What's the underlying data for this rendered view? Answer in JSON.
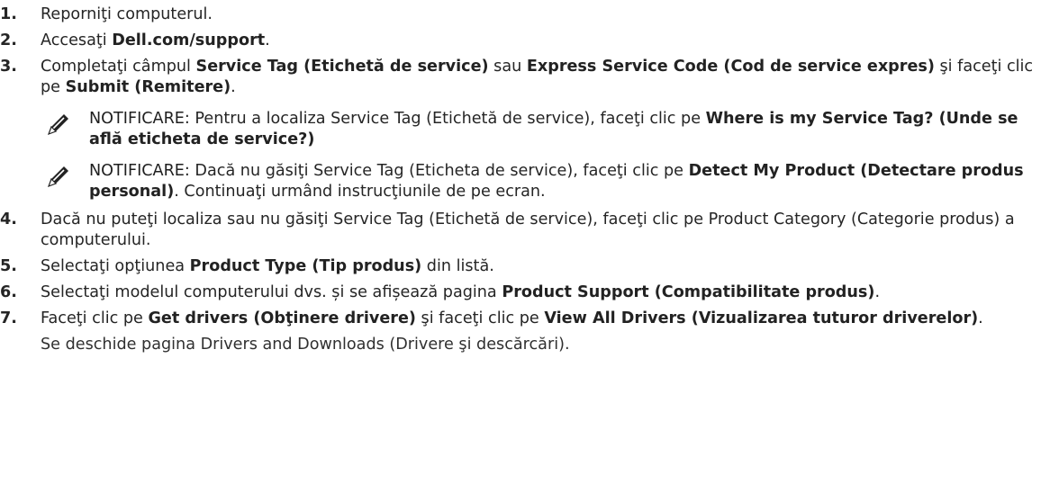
{
  "steps": [
    {
      "num": "1.",
      "parts": [
        {
          "t": "Reporniţi computerul.",
          "b": false
        }
      ]
    },
    {
      "num": "2.",
      "parts": [
        {
          "t": "Accesaţi ",
          "b": false
        },
        {
          "t": "Dell.com/support",
          "b": true
        },
        {
          "t": ".",
          "b": false
        }
      ]
    },
    {
      "num": "3.",
      "parts": [
        {
          "t": "Completaţi câmpul ",
          "b": false
        },
        {
          "t": "Service Tag (Etichetă de service)",
          "b": true
        },
        {
          "t": " sau ",
          "b": false
        },
        {
          "t": "Express Service Code (Cod de service expres)",
          "b": true
        },
        {
          "t": " şi faceţi clic pe ",
          "b": false
        },
        {
          "t": "Submit (Remitere)",
          "b": true
        },
        {
          "t": ".",
          "b": false
        }
      ]
    },
    {
      "num": "4.",
      "parts": [
        {
          "t": "Dacă nu puteţi localiza sau nu găsiţi Service Tag (Etichetă de service), faceţi clic pe Product Category (Categorie produs) a computerului.",
          "b": false
        }
      ]
    },
    {
      "num": "5.",
      "parts": [
        {
          "t": "Selectaţi opţiunea ",
          "b": false
        },
        {
          "t": "Product Type (Tip produs)",
          "b": true
        },
        {
          "t": " din listă.",
          "b": false
        }
      ]
    },
    {
      "num": "6.",
      "parts": [
        {
          "t": "Selectaţi modelul computerului dvs. și se afișează pagina ",
          "b": false
        },
        {
          "t": "Product Support (Compatibilitate produs)",
          "b": true
        },
        {
          "t": ".",
          "b": false
        }
      ]
    },
    {
      "num": "7.",
      "parts": [
        {
          "t": "Faceţi clic pe ",
          "b": false
        },
        {
          "t": "Get drivers (Obţinere drivere)",
          "b": true
        },
        {
          "t": " şi faceţi clic pe ",
          "b": false
        },
        {
          "t": "View All Drivers (Vizualizarea tuturor driverelor)",
          "b": true
        },
        {
          "t": ".",
          "b": false
        }
      ]
    }
  ],
  "notes": [
    {
      "label": "NOTIFICARE:",
      "parts": [
        {
          "t": " Pentru a localiza Service Tag (Etichetă de service), faceţi clic pe ",
          "b": false
        },
        {
          "t": "Where is my Service Tag? (Unde se află eticheta de service?)",
          "b": true
        }
      ]
    },
    {
      "label": "NOTIFICARE:",
      "parts": [
        {
          "t": " Dacă nu găsiţi Service Tag (Eticheta de service), faceţi clic pe ",
          "b": false
        },
        {
          "t": "Detect My Product (Detectare produs personal)",
          "b": true
        },
        {
          "t": ". Continuaţi urmând instrucţiunile de pe ecran.",
          "b": false
        }
      ]
    }
  ],
  "closing_text": "Se deschide pagina Drivers and Downloads (Drivere şi descărcări).",
  "icons": {
    "note": "pencil-note-icon"
  },
  "colors": {
    "text": "#252525"
  }
}
